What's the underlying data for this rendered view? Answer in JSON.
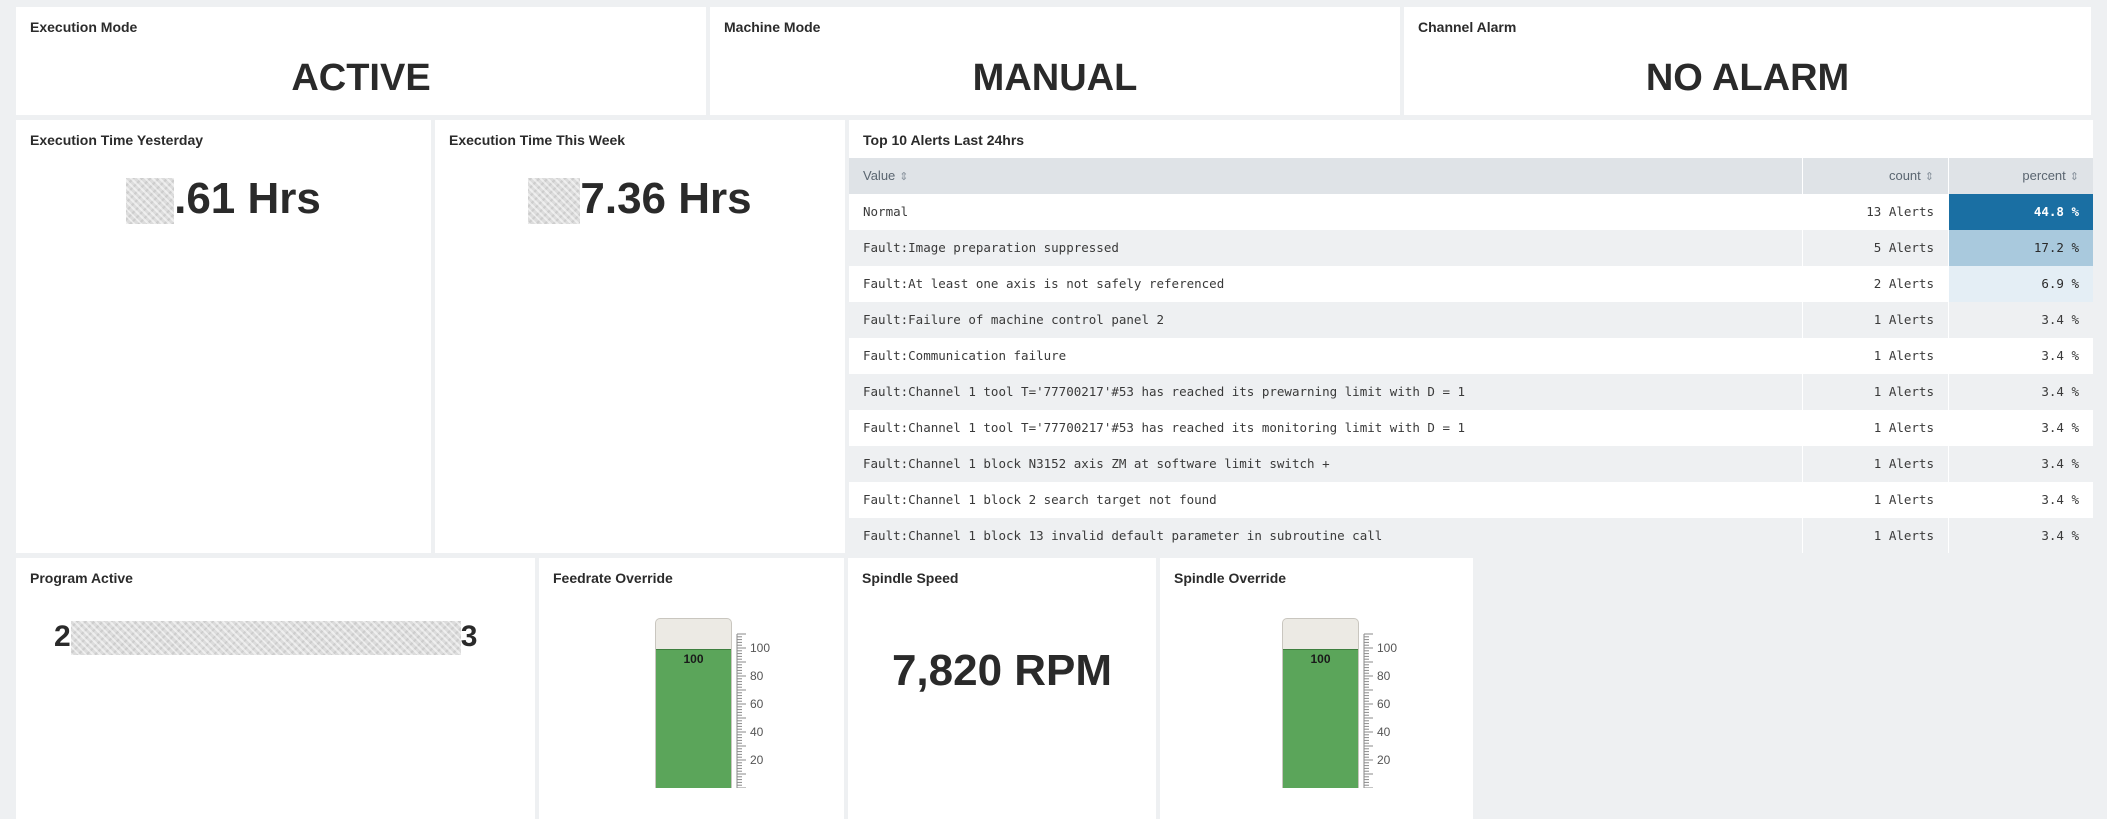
{
  "execution_mode": {
    "title": "Execution Mode",
    "value": "ACTIVE"
  },
  "machine_mode": {
    "title": "Machine Mode",
    "value": "MANUAL"
  },
  "channel_alarm": {
    "title": "Channel Alarm",
    "value": "NO ALARM"
  },
  "exec_yesterday": {
    "title": "Execution Time Yesterday",
    "value": ".61 Hrs"
  },
  "exec_week": {
    "title": "Execution Time This Week",
    "value": "7.36 Hrs"
  },
  "alerts": {
    "title": "Top 10 Alerts Last 24hrs",
    "headers": {
      "value": "Value",
      "count": "count",
      "percent": "percent"
    },
    "sort_glyph": "⇕",
    "rows": [
      {
        "value": "Normal",
        "count": "13 Alerts",
        "percent": "44.8 %",
        "pct_num": 44.8,
        "heat": "#1a6fa3",
        "text_color": "#ffffff"
      },
      {
        "value": "Fault:Image preparation suppressed",
        "count": "5 Alerts",
        "percent": "17.2 %",
        "pct_num": 17.2,
        "heat": "#a9c9dd",
        "text_color": "#2a2a2a"
      },
      {
        "value": "Fault:At least one axis is not safely referenced",
        "count": "2 Alerts",
        "percent": "6.9 %",
        "pct_num": 6.9,
        "heat": "#e4eef5",
        "text_color": "#2a2a2a"
      },
      {
        "value": "Fault:Failure of machine control panel 2",
        "count": "1 Alerts",
        "percent": "3.4 %",
        "pct_num": 3.4,
        "heat": "",
        "text_color": "#3a3a3a"
      },
      {
        "value": "Fault:Communication failure",
        "count": "1 Alerts",
        "percent": "3.4 %",
        "pct_num": 3.4,
        "heat": "",
        "text_color": "#3a3a3a"
      },
      {
        "value": "Fault:Channel 1 tool T='77700217'#53 has reached its prewarning limit with D = 1",
        "count": "1 Alerts",
        "percent": "3.4 %",
        "pct_num": 3.4,
        "heat": "",
        "text_color": "#3a3a3a"
      },
      {
        "value": "Fault:Channel 1 tool T='77700217'#53 has reached its monitoring limit with D = 1",
        "count": "1 Alerts",
        "percent": "3.4 %",
        "pct_num": 3.4,
        "heat": "",
        "text_color": "#3a3a3a"
      },
      {
        "value": "Fault:Channel 1 block N3152 axis ZM at software limit switch +",
        "count": "1 Alerts",
        "percent": "3.4 %",
        "pct_num": 3.4,
        "heat": "",
        "text_color": "#3a3a3a"
      },
      {
        "value": "Fault:Channel 1 block 2 search target not found",
        "count": "1 Alerts",
        "percent": "3.4 %",
        "pct_num": 3.4,
        "heat": "",
        "text_color": "#3a3a3a"
      },
      {
        "value": "Fault:Channel 1 block 13 invalid default parameter in subroutine call",
        "count": "1 Alerts",
        "percent": "3.4 %",
        "pct_num": 3.4,
        "heat": "",
        "text_color": "#3a3a3a"
      }
    ]
  },
  "program_active": {
    "title": "Program Active",
    "prefix": "2",
    "suffix": "3"
  },
  "feedrate": {
    "title": "Feedrate Override",
    "value": 100,
    "value_label": "100",
    "max": 110,
    "ticks": [
      "100",
      "80",
      "60",
      "40",
      "20"
    ]
  },
  "spindle_speed": {
    "title": "Spindle Speed",
    "value": "7,820 RPM"
  },
  "spindle_override": {
    "title": "Spindle Override",
    "value": 100,
    "value_label": "100",
    "max": 110,
    "ticks": [
      "100",
      "80",
      "60",
      "40",
      "20"
    ]
  },
  "colors": {
    "gauge_fill": "#5ba55a",
    "heat_high": "#1a6fa3"
  }
}
